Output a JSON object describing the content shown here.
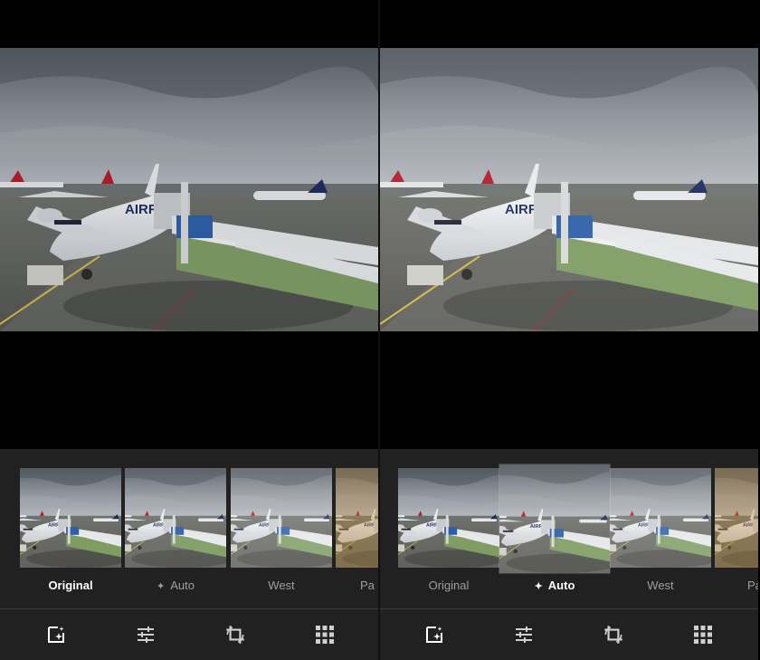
{
  "panels": [
    {
      "id": "before",
      "filters": [
        {
          "label": "Original",
          "active": true,
          "auto_icon": false
        },
        {
          "label": "Auto",
          "active": false,
          "auto_icon": true
        },
        {
          "label": "West",
          "active": false,
          "auto_icon": false
        },
        {
          "label": "Pa",
          "active": false,
          "auto_icon": false
        }
      ]
    },
    {
      "id": "after",
      "filters": [
        {
          "label": "Original",
          "active": false,
          "auto_icon": false
        },
        {
          "label": "Auto",
          "active": true,
          "auto_icon": true
        },
        {
          "label": "West",
          "active": false,
          "auto_icon": false
        },
        {
          "label": "Pa",
          "active": false,
          "auto_icon": false
        }
      ]
    }
  ],
  "toolbar": {
    "tools": [
      {
        "icon": "auto-enhance-icon",
        "active": true
      },
      {
        "icon": "adjust-sliders-icon",
        "active": false
      },
      {
        "icon": "crop-rotate-icon",
        "active": false
      },
      {
        "icon": "filter-grid-icon",
        "active": false
      }
    ]
  },
  "photo": {
    "fuselage_text": "AIRFE"
  },
  "colors": {
    "background": "#000000",
    "strip": "#212121",
    "active_label": "#ffffff",
    "inactive_label": "#9e9e9e",
    "tool_icon": "#e0e0e0"
  }
}
